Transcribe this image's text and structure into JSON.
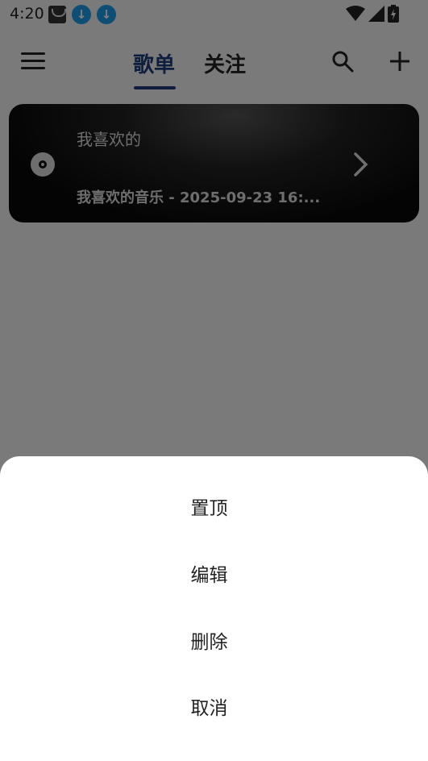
{
  "status_bar": {
    "time": "4:20",
    "notifications": [
      "mail-icon",
      "download-icon",
      "download-icon"
    ],
    "system_icons": [
      "wifi-icon",
      "signal-icon",
      "battery-icon"
    ]
  },
  "header": {
    "menu_icon": "menu-icon",
    "tabs": [
      {
        "label": "歌单",
        "active": true
      },
      {
        "label": "关注",
        "active": false
      }
    ],
    "actions": [
      "search-icon",
      "add-icon"
    ],
    "accent_color": "#1f3d7a"
  },
  "playlist_card": {
    "title": "我喜欢的",
    "subtitle": "我喜欢的音乐 - 2025-09-23 16:..."
  },
  "action_sheet": {
    "items": [
      {
        "label": "置顶"
      },
      {
        "label": "编辑"
      },
      {
        "label": "删除"
      },
      {
        "label": "取消"
      }
    ]
  }
}
